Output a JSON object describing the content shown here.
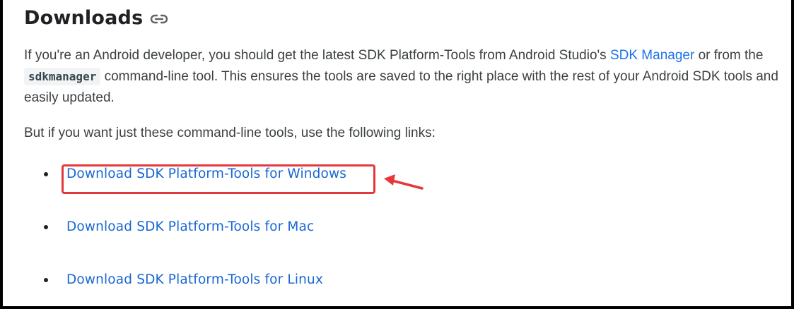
{
  "heading": {
    "title": "Downloads",
    "anchor_icon": "link-icon"
  },
  "intro": {
    "text_before_link": "If you're an Android developer, you should get the latest SDK Platform-Tools from Android Studio's ",
    "link_label": "SDK Manager",
    "text_after_link": " or from the ",
    "code": "sdkmanager",
    "text_end": " command-line tool. This ensures the tools are saved to the right place with the rest of your Android SDK tools and easily updated."
  },
  "instruction": "But if you want just these command-line tools, use the following links:",
  "downloads": [
    {
      "label": "Download SDK Platform-Tools for Windows",
      "highlighted": true
    },
    {
      "label": "Download SDK Platform-Tools for Mac",
      "highlighted": false
    },
    {
      "label": "Download SDK Platform-Tools for Linux",
      "highlighted": false
    }
  ],
  "annotation": {
    "highlight_color": "#e5383b",
    "arrow_icon": "arrow-left-icon"
  },
  "colors": {
    "link": "#1967d2",
    "text": "#3c4043",
    "heading": "#202124",
    "frame": "#000000"
  }
}
